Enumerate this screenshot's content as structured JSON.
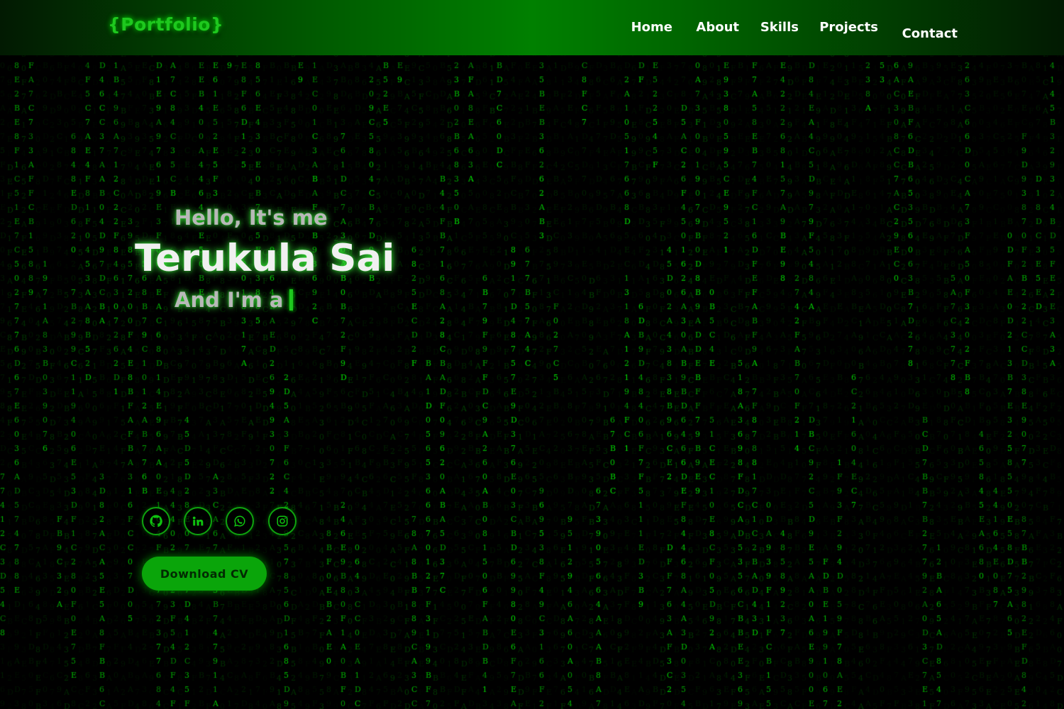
{
  "navbar": {
    "logo": "{Portfolio}",
    "links": [
      {
        "label": "Home"
      },
      {
        "label": "About"
      },
      {
        "label": "Skills"
      },
      {
        "label": "Projects"
      },
      {
        "label": "Contact"
      }
    ]
  },
  "hero": {
    "greeting": "Hello, It's me",
    "name": "Terukula Sai",
    "role_prefix": "And I'm a"
  },
  "socials": [
    {
      "icon": "github-icon"
    },
    {
      "icon": "linkedin-icon"
    },
    {
      "icon": "whatsapp-icon"
    },
    {
      "icon": "instagram-icon"
    }
  ],
  "cv_button": {
    "label": "Download CV"
  },
  "theme": {
    "accent": "#00ff00",
    "accent_dark": "#0aa50a",
    "background": "#000000"
  }
}
